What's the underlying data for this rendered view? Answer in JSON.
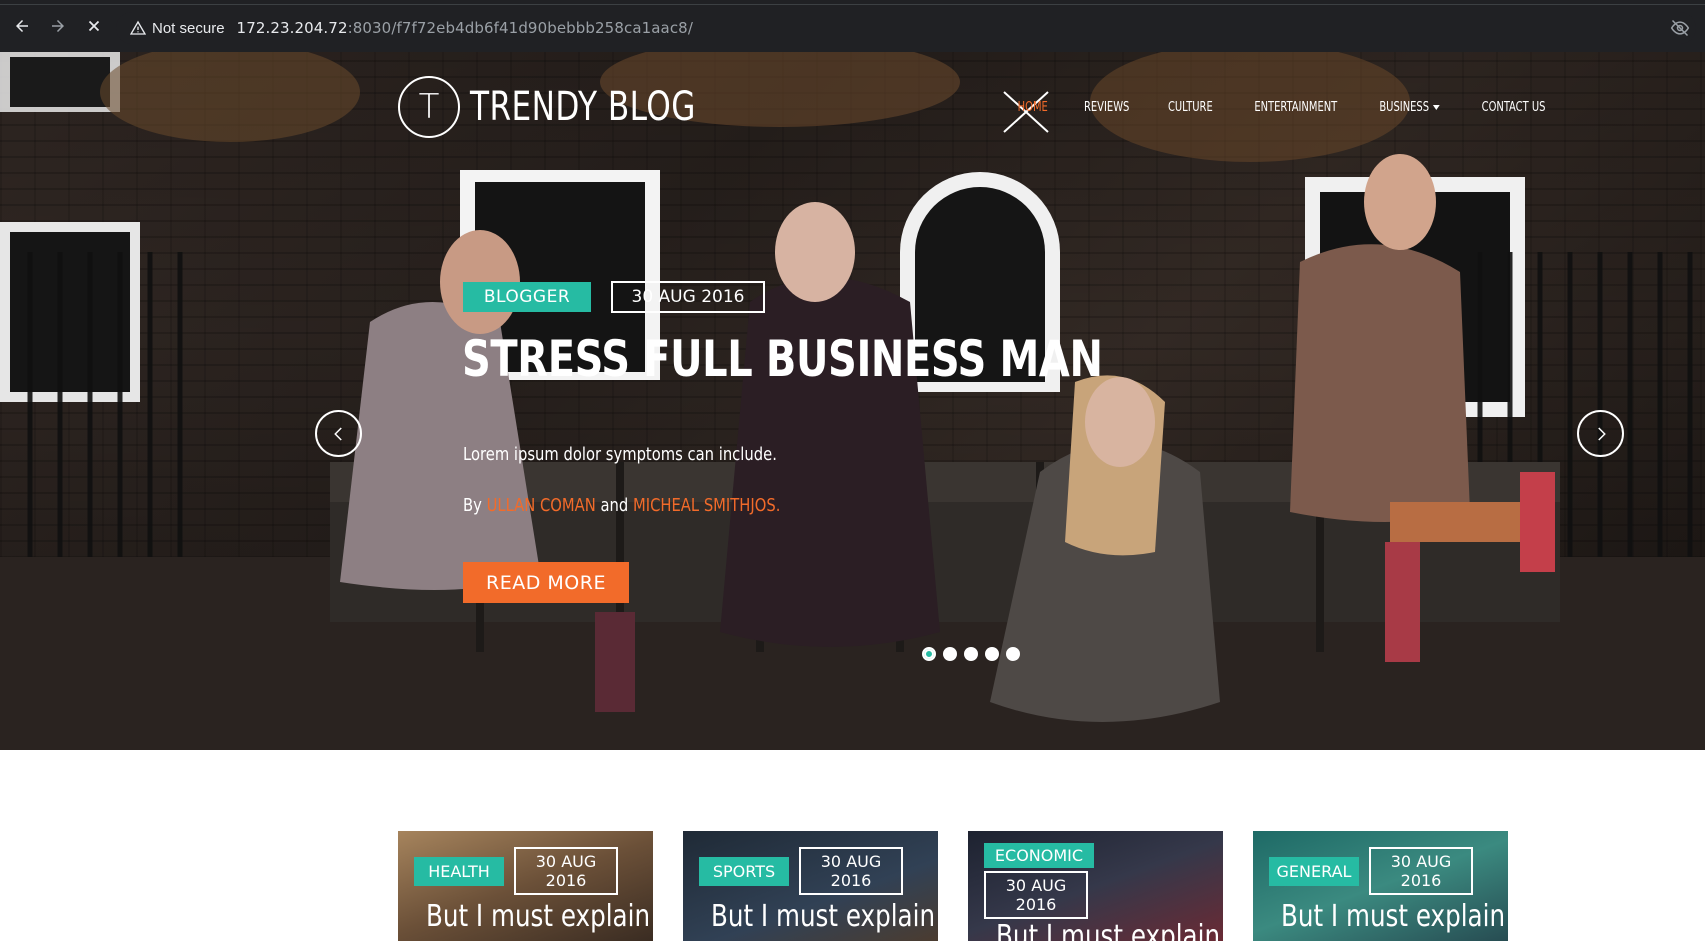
{
  "browser": {
    "security_label": "Not secure",
    "url_host": "172.23.204.72",
    "url_path": ":8030/f7f72eb4db6f41d90bebbb258ca1aac8/"
  },
  "site": {
    "logo_letter": "T",
    "name": "TRENDY BLOG"
  },
  "menu": {
    "items": [
      "HOME",
      "REVIEWS",
      "CULTURE",
      "ENTERTAINMENT",
      "BUSINESS",
      "CONTACT US"
    ],
    "active": "HOME"
  },
  "hero": {
    "category": "BLOGGER",
    "date": "30 AUG 2016",
    "title": "STRESS FULL BUSINESS MAN",
    "description": "Lorem ipsum dolor symptoms can include.",
    "by_prefix": "By",
    "author1": "ULLAN COMAN",
    "conjunction": "and",
    "author2": "MICHEAL SMITHJOS.",
    "cta": "READ MORE",
    "slides": 5,
    "active_slide": 1
  },
  "cards": [
    {
      "category": "HEALTH",
      "date": "30 AUG 2016",
      "title": "But I must explain"
    },
    {
      "category": "SPORTS",
      "date": "30 AUG 2016",
      "title": "But I must explain"
    },
    {
      "category": "ECONOMIC",
      "date": "30 AUG 2016",
      "title": "But I must explain"
    },
    {
      "category": "GENERAL",
      "date": "30 AUG 2016",
      "title": "But I must explain"
    }
  ],
  "colors": {
    "accent_teal": "#26bba3",
    "accent_orange": "#f26b2a",
    "chrome_bg": "#202124"
  }
}
